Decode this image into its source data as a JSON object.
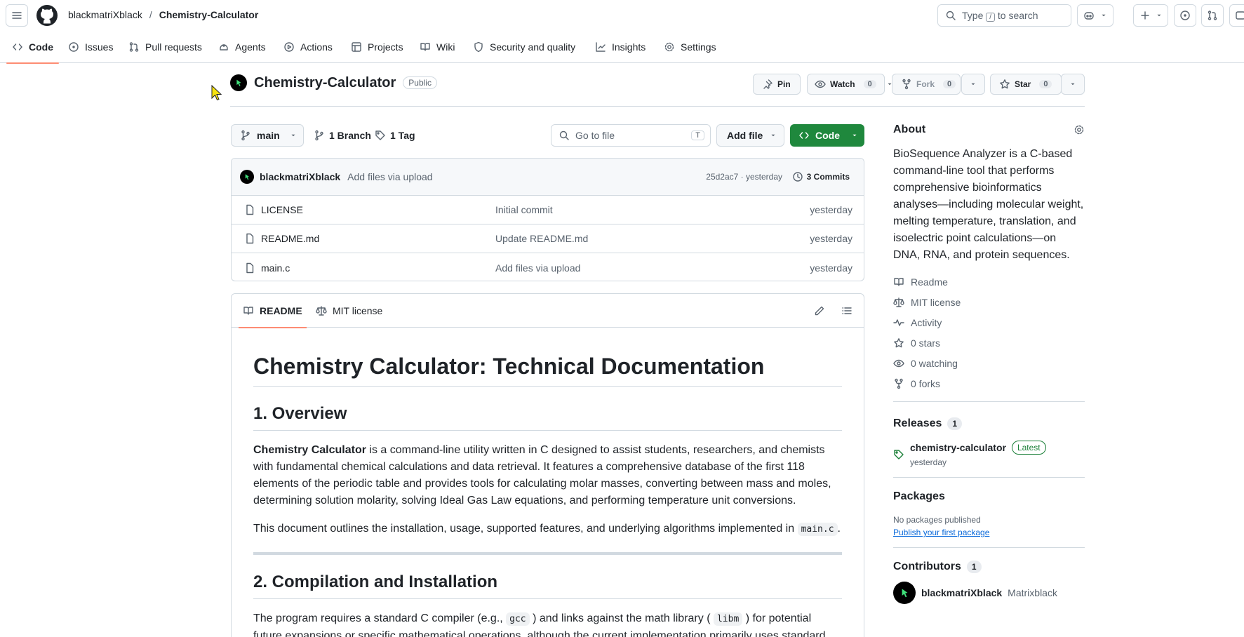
{
  "header": {
    "owner": "blackmatriXblack",
    "separator": "/",
    "repo": "Chemistry-Calculator",
    "search_type": "Type",
    "search_key": "/",
    "search_suffix": "to search"
  },
  "nav": {
    "tabs": [
      {
        "label": "Code"
      },
      {
        "label": "Issues"
      },
      {
        "label": "Pull requests"
      },
      {
        "label": "Agents"
      },
      {
        "label": "Actions"
      },
      {
        "label": "Projects"
      },
      {
        "label": "Wiki"
      },
      {
        "label": "Security and quality"
      },
      {
        "label": "Insights"
      },
      {
        "label": "Settings"
      }
    ]
  },
  "repo": {
    "title": "Chemistry-Calculator",
    "visibility": "Public",
    "pin_label": "Pin",
    "watch_label": "Watch",
    "watch_count": "0",
    "fork_label": "Fork",
    "fork_count": "0",
    "star_label": "Star",
    "star_count": "0"
  },
  "branchbar": {
    "branch": "main",
    "branches": "1 Branch",
    "tags": "1 Tag",
    "goto_placeholder": "Go to file",
    "goto_key": "T",
    "add_file": "Add file",
    "code": "Code"
  },
  "commit": {
    "author": "blackmatriXblack",
    "message": "Add files via upload",
    "hash_time": "25d2ac7 · yesterday",
    "commits": "3 Commits"
  },
  "files": [
    {
      "name": "LICENSE",
      "message": "Initial commit",
      "time": "yesterday"
    },
    {
      "name": "README.md",
      "message": "Update README.md",
      "time": "yesterday"
    },
    {
      "name": "main.c",
      "message": "Add files via upload",
      "time": "yesterday"
    }
  ],
  "readme": {
    "tab_readme": "README",
    "tab_license": "MIT license",
    "h1": "Chemistry Calculator: Technical Documentation",
    "h2_overview": "1. Overview",
    "p1_bold": "Chemistry Calculator",
    "p1_rest": " is a command-line utility written in C designed to assist students, researchers, and chemists with fundamental chemical calculations and data retrieval. It features a comprehensive database of the first 118 elements of the periodic table and provides tools for calculating molar masses, converting between mass and moles, determining solution molarity, solving Ideal Gas Law equations, and performing temperature unit conversions.",
    "p2_text": "This document outlines the installation, usage, supported features, and underlying algorithms implemented in ",
    "p2_code": "main.c",
    "p2_end": ".",
    "h2_compile": "2. Compilation and Installation",
    "p3_a": "The program requires a standard C compiler (e.g., ",
    "p3_code1": "gcc",
    "p3_b": " ) and links against the math library ( ",
    "p3_code2": "libm",
    "p3_c": " ) for potential future expansions or specific mathematical operations, although the current implementation primarily uses standard"
  },
  "about": {
    "heading": "About",
    "description": "BioSequence Analyzer is a C-based command-line tool that performs comprehensive bioinformatics analyses—including molecular weight, melting temperature, translation, and isoelectric point calculations—on DNA, RNA, and protein sequences.",
    "links": [
      {
        "label": "Readme",
        "icon": "book-icon"
      },
      {
        "label": "MIT license",
        "icon": "scale-icon"
      },
      {
        "label": "Activity",
        "icon": "pulse-icon"
      },
      {
        "label": "0 stars",
        "icon": "star-icon"
      },
      {
        "label": "0 watching",
        "icon": "eye-icon"
      },
      {
        "label": "0 forks",
        "icon": "fork-icon"
      }
    ]
  },
  "releases": {
    "heading": "Releases",
    "count": "1",
    "name": "chemistry-calculator",
    "badge": "Latest",
    "time": "yesterday"
  },
  "packages": {
    "heading": "Packages",
    "none": "No packages published",
    "link": "Publish your first package"
  },
  "contributors": {
    "heading": "Contributors",
    "count": "1",
    "login": "blackmatriXblack",
    "name": "Matrixblack"
  },
  "colors": {
    "accent_green": "#1f883d",
    "tab_underline": "#fd8c73",
    "link_blue": "#0969da"
  }
}
